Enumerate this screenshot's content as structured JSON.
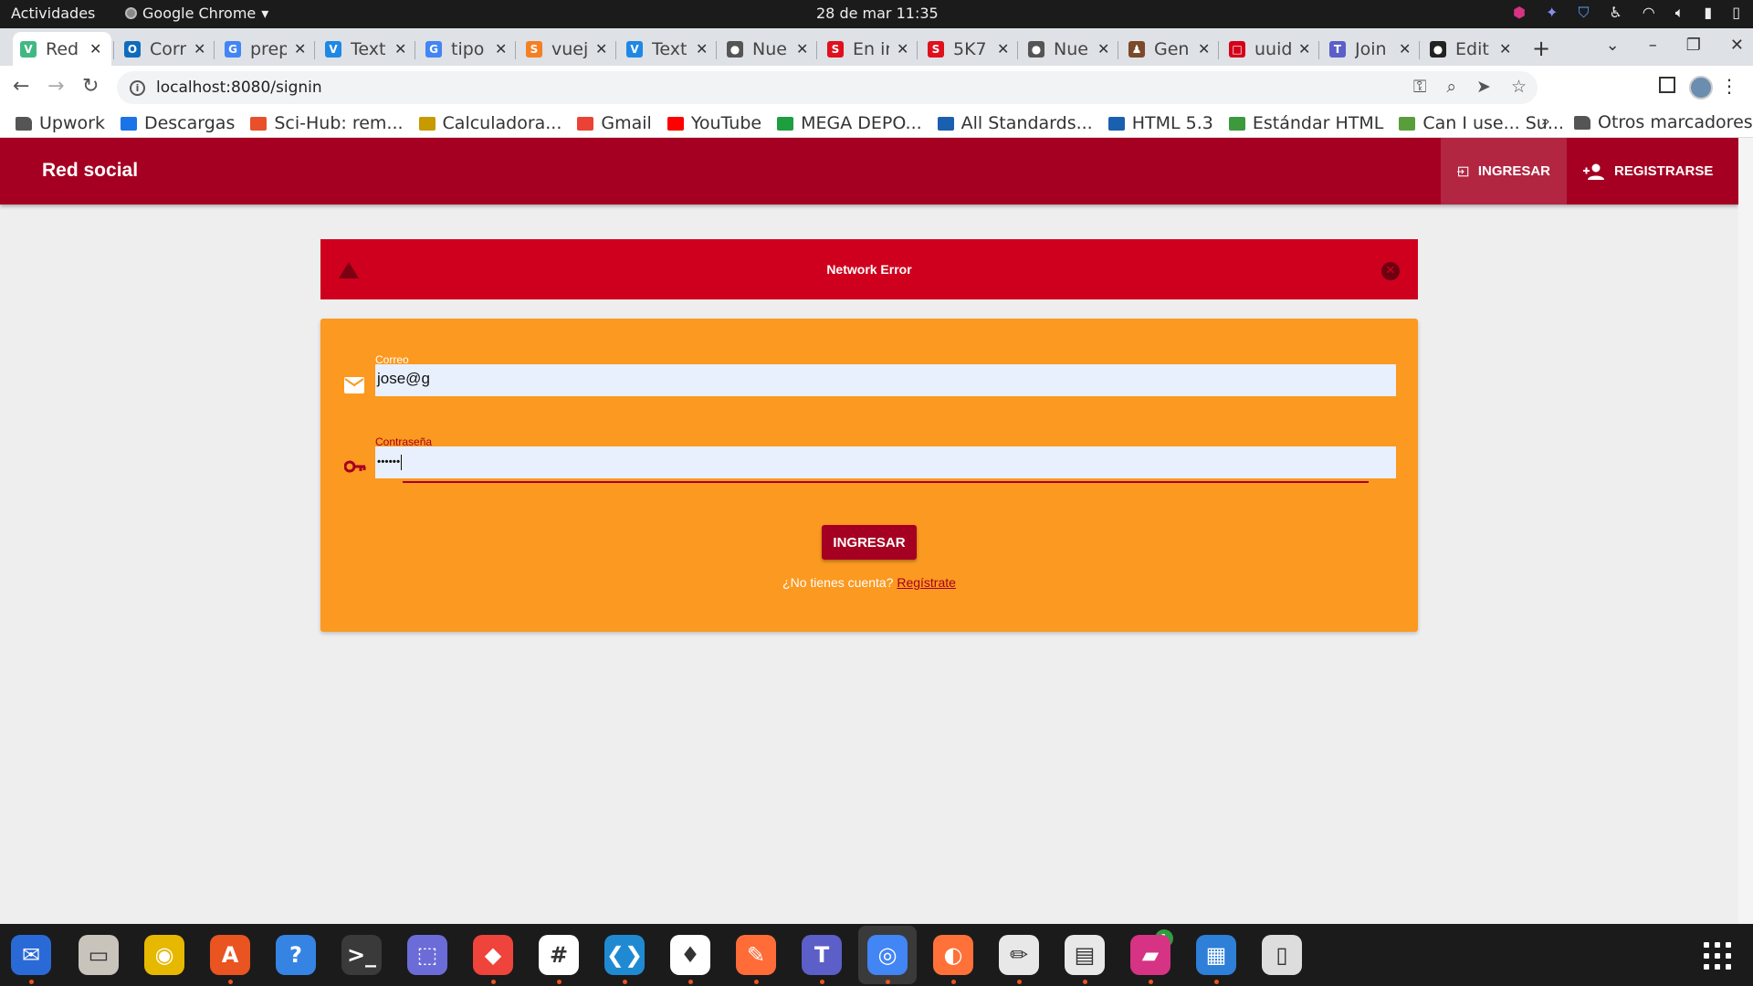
{
  "system": {
    "activities": "Actividades",
    "app_name": "Google Chrome",
    "clock": "28 de mar  11:35"
  },
  "tabs": [
    {
      "title": "Red",
      "color": "#41b883",
      "glyph": "V"
    },
    {
      "title": "Corr",
      "color": "#0f6cbd",
      "glyph": "O"
    },
    {
      "title": "prep",
      "color": "#4285f4",
      "glyph": "G"
    },
    {
      "title": "Text",
      "color": "#1e88e5",
      "glyph": "V"
    },
    {
      "title": "tipo",
      "color": "#4285f4",
      "glyph": "G"
    },
    {
      "title": "vuej",
      "color": "#f48024",
      "glyph": "S"
    },
    {
      "title": "Text",
      "color": "#1e88e5",
      "glyph": "V"
    },
    {
      "title": "Nue",
      "color": "#555555",
      "glyph": "●"
    },
    {
      "title": "En ir",
      "color": "#e0101d",
      "glyph": "S"
    },
    {
      "title": "5K7",
      "color": "#e0101d",
      "glyph": "S"
    },
    {
      "title": "Nue",
      "color": "#555555",
      "glyph": "●"
    },
    {
      "title": "Gen",
      "color": "#7a4a2a",
      "glyph": "♟"
    },
    {
      "title": "uuid",
      "color": "#d4001a",
      "glyph": "□"
    },
    {
      "title": "Join",
      "color": "#5b5fc7",
      "glyph": "T"
    },
    {
      "title": "Edit",
      "color": "#222222",
      "glyph": "●"
    }
  ],
  "omnibox": {
    "url": "localhost:8080/signin"
  },
  "bookmarks": [
    {
      "label": "Upwork",
      "color": "#555555",
      "folder": true
    },
    {
      "label": "Descargas",
      "color": "#1a73e8"
    },
    {
      "label": "Sci-Hub: rem...",
      "color": "#e8502a"
    },
    {
      "label": "Calculadora...",
      "color": "#c79a00"
    },
    {
      "label": "Gmail",
      "color": "#ea4335"
    },
    {
      "label": "YouTube",
      "color": "#ff0000"
    },
    {
      "label": "MEGA DEPO...",
      "color": "#1d9e3f"
    },
    {
      "label": "All Standards...",
      "color": "#1b5fb0"
    },
    {
      "label": "HTML 5.3",
      "color": "#1b5fb0"
    },
    {
      "label": "Estándar HTML",
      "color": "#3c9a3c"
    },
    {
      "label": "Can I use... Su...",
      "color": "#5a9e3c"
    }
  ],
  "bookmarks_more": "»",
  "bookmarks_other": "Otros marcadores",
  "app": {
    "brand": "Red social",
    "nav_login": "INGRESAR",
    "nav_register": "REGISTRARSE"
  },
  "alert": {
    "message": "Network Error"
  },
  "form": {
    "email_label": "Correo",
    "email_value": "jose@g",
    "password_label": "Contraseña",
    "password_value": "••••••",
    "submit_label": "INGRESAR",
    "no_account": "¿No tienes cuenta?",
    "signup_link": "Regístrate"
  },
  "colors": {
    "brand": "#a50022",
    "alert": "#cf001d",
    "card": "#fb9920"
  },
  "dock": [
    {
      "name": "thunderbird-icon",
      "color": "#2a6ad6",
      "glyph": "✉"
    },
    {
      "name": "files-icon",
      "color": "#c8c4bc",
      "glyph": "▭"
    },
    {
      "name": "rhythmbox-icon",
      "color": "#e6b800",
      "glyph": "◉"
    },
    {
      "name": "software-center-icon",
      "color": "#e95420",
      "glyph": "A"
    },
    {
      "name": "help-icon",
      "color": "#3584e4",
      "glyph": "?"
    },
    {
      "name": "terminal-icon",
      "color": "#3a3a3a",
      "glyph": ">_"
    },
    {
      "name": "screenshot-icon",
      "color": "#6c6cd8",
      "glyph": "⬚"
    },
    {
      "name": "anydesk-icon",
      "color": "#ef443b",
      "glyph": "◆"
    },
    {
      "name": "slack-icon",
      "color": "#ffffff",
      "glyph": "#"
    },
    {
      "name": "vscode-icon",
      "color": "#1f8ad2",
      "glyph": "❮❯"
    },
    {
      "name": "mongodb-icon",
      "color": "#ffffff",
      "glyph": "♦"
    },
    {
      "name": "postman-icon",
      "color": "#ff6c37",
      "glyph": "✎"
    },
    {
      "name": "teams-icon",
      "color": "#5b5fc7",
      "glyph": "T"
    },
    {
      "name": "chrome-icon",
      "color": "#4285f4",
      "glyph": "◎"
    },
    {
      "name": "firefox-icon",
      "color": "#ff7139",
      "glyph": "◐"
    },
    {
      "name": "text-editor-icon",
      "color": "#e8e8e8",
      "glyph": "✏"
    },
    {
      "name": "document-viewer-icon",
      "color": "#e8e8e8",
      "glyph": "▤"
    },
    {
      "name": "phpstorm-icon",
      "color": "#d63384",
      "glyph": "▰"
    },
    {
      "name": "security-shield-icon",
      "color": "#2d7fd8",
      "glyph": "▦"
    },
    {
      "name": "ipod-icon",
      "color": "#dddddd",
      "glyph": "▯"
    }
  ],
  "dock_badge": "1"
}
